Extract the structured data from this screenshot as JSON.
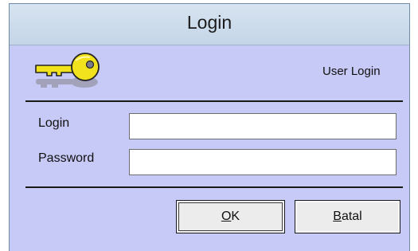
{
  "window": {
    "title": "Login",
    "subtitle": "User Login"
  },
  "form": {
    "login_label": "Login",
    "login_value": "",
    "password_label": "Password",
    "password_value": ""
  },
  "buttons": {
    "ok": {
      "mnemonic": "O",
      "rest": "K"
    },
    "cancel": {
      "mnemonic": "B",
      "rest": "atal"
    }
  },
  "colors": {
    "body": "#c7c9f6",
    "titlebar": "#d7e4f1",
    "key": "#f2e21e"
  },
  "icons": {
    "header": "key-icon"
  }
}
